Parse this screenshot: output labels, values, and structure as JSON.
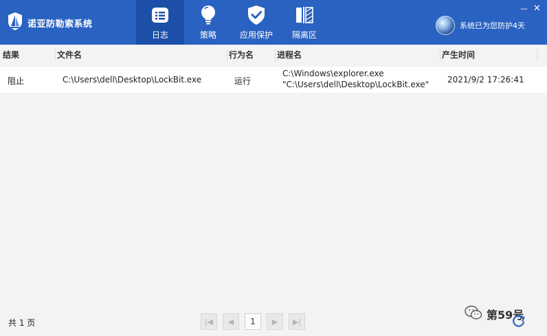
{
  "app": {
    "title": "诺亚防勒索系统",
    "status": "系统已为您防护4天"
  },
  "nav": {
    "items": [
      {
        "label": "日志",
        "icon": "log-list-icon",
        "active": true
      },
      {
        "label": "策略",
        "icon": "lightbulb-icon",
        "active": false
      },
      {
        "label": "应用保护",
        "icon": "shield-check-icon",
        "active": false
      },
      {
        "label": "隔离区",
        "icon": "quarantine-icon",
        "active": false
      }
    ]
  },
  "window": {
    "minimize": "—",
    "close": "✕"
  },
  "table": {
    "columns": [
      "结果",
      "文件名",
      "行为名",
      "进程名",
      "产生时间"
    ],
    "rows": [
      {
        "result": "阻止",
        "file": "C:\\Users\\dell\\Desktop\\LockBit.exe",
        "action": "运行",
        "process_line1": "C:\\Windows\\explorer.exe",
        "process_line2": "\"C:\\Users\\dell\\Desktop\\LockBit.exe\"",
        "time": "2021/9/2 17:26:41"
      }
    ]
  },
  "footer": {
    "count": "共 1 页",
    "pager": {
      "first": "|◀",
      "prev": "◀",
      "page": "1",
      "next": "▶",
      "last": "▶|"
    }
  },
  "watermark": {
    "text": "第59号"
  },
  "colors": {
    "accent": "#2a62c1",
    "active_tab": "#1b4fa8"
  }
}
